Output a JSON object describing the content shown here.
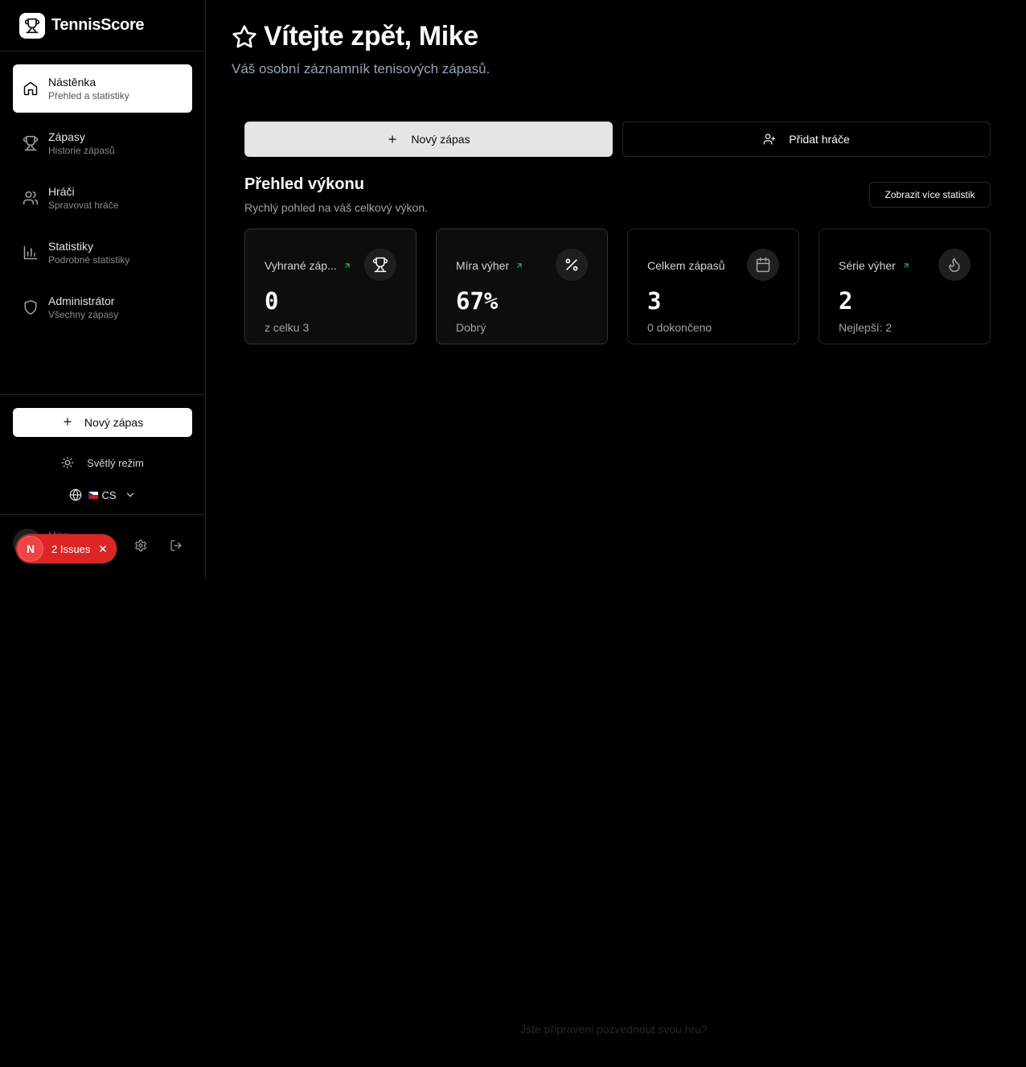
{
  "brand": {
    "name": "TennisScore"
  },
  "sidebar": {
    "items": [
      {
        "label": "Nástěnka",
        "sub": "Přehled a statistiky"
      },
      {
        "label": "Zápasy",
        "sub": "Historie zápasů"
      },
      {
        "label": "Hráči",
        "sub": "Spravovat hráče"
      },
      {
        "label": "Statistiky",
        "sub": "Podrobné statistiky"
      },
      {
        "label": "Administrátor",
        "sub": "Všechny zápasy"
      }
    ],
    "new_match": "Nový zápas",
    "theme": "Světlý režim",
    "language": "CS",
    "user_name": "Mike"
  },
  "issues": {
    "badge": "N",
    "label": "2 Issues"
  },
  "main": {
    "welcome": "Vítejte zpět, Mike",
    "subtitle": "Váš osobní záznamník tenisových zápasů.",
    "new_match": "Nový zápas",
    "add_player": "Přidat hráče",
    "perf_title": "Přehled výkonu",
    "perf_sub": "Rychlý pohled na váš celkový výkon.",
    "more_stats": "Zobrazit více statistik",
    "cards": [
      {
        "title": "Vyhrané záp...",
        "value": "0",
        "desc": "z celku 3",
        "icon": "trophy-icon"
      },
      {
        "title": "Míra výher",
        "value": "67%",
        "desc": "Dobrý",
        "icon": "percent-icon"
      },
      {
        "title": "Celkem zápasů",
        "value": "3",
        "desc": "0 dokončeno",
        "icon": "calendar-icon"
      },
      {
        "title": "Série výher",
        "value": "2",
        "desc": "Nejlepší: 2",
        "icon": "flame-icon"
      }
    ],
    "footer": "Jste připraveni pozvednout svou hru?"
  },
  "colors": {
    "accent_up": "#22c55e",
    "issues_red": "#dc2626",
    "subtitle": "#94a3b8"
  }
}
